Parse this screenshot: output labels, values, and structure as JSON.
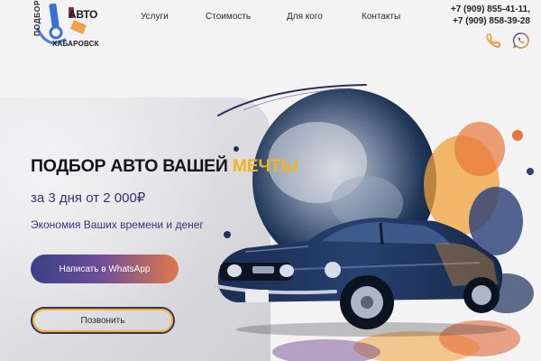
{
  "logo": {
    "vertical_text": "ПОДБОР",
    "auto_text": "АВТО",
    "city_text": "ХАБАРОВСК"
  },
  "nav": {
    "items": [
      {
        "label": "Услуги"
      },
      {
        "label": "Стоимость"
      },
      {
        "label": "Для кого"
      },
      {
        "label": "Контакты"
      }
    ]
  },
  "contacts": {
    "phone_1": "+7 (909) 855-41-11,",
    "phone_2": "+7 (909) 858-39-28",
    "icons": [
      "phone-icon",
      "whatsapp-icon"
    ]
  },
  "hero": {
    "title_main": "ПОДБОР АВТО ВАШЕЙ ",
    "title_accent": "МЕЧТЫ",
    "subtitle": "за 3 дня от 2 000₽",
    "tagline": "Экономия Ваших времени и денег",
    "whatsapp_button": "Написать в WhatsApp",
    "call_button": "Позвонить"
  },
  "colors": {
    "accent": "#f2b31e",
    "brand_dark": "#2f3270",
    "text_purple": "#3c2f74"
  }
}
